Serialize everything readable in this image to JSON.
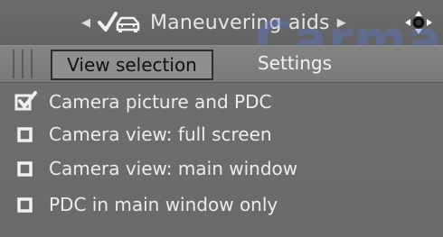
{
  "header": {
    "title": "Maneuvering aids",
    "left_arrow_icon": "arrow-left-small",
    "right_arrow_icon": "arrow-right-small",
    "title_icon": "car-check-icon",
    "controller_icon": "idrive-controller-icon",
    "watermark": "Carmac"
  },
  "tabs": [
    {
      "label": "View selection",
      "active": true
    },
    {
      "label": "Settings",
      "active": false
    }
  ],
  "options": [
    {
      "label": "Camera picture and PDC",
      "checked": true
    },
    {
      "label": "Camera view: full screen",
      "checked": false
    },
    {
      "label": "Camera view: main window",
      "checked": false
    },
    {
      "label": "PDC in main window only",
      "checked": false
    }
  ],
  "colors": {
    "background": "#6e6e6e",
    "tab_bar": "#808080",
    "active_tab_border": "#2d2d2d",
    "text": "#e9e9e9",
    "watermark": "#5a78d2"
  }
}
